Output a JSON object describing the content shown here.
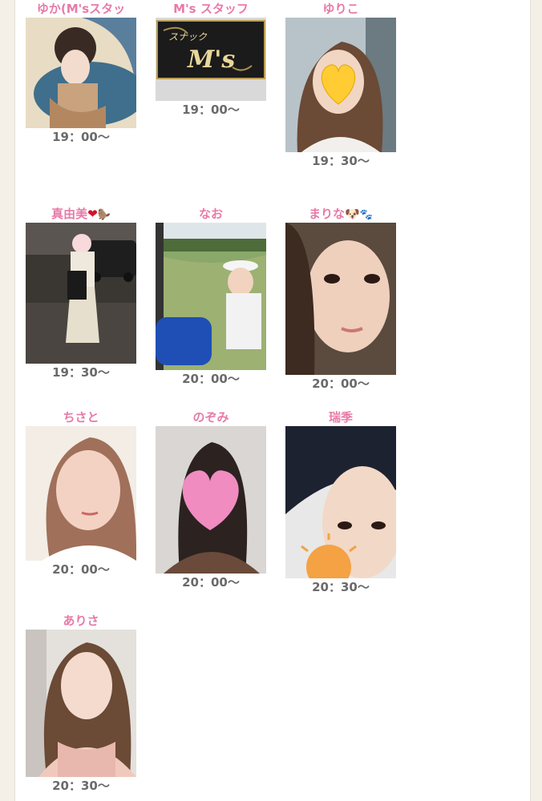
{
  "cast": [
    {
      "name": "ゆか(M'sスタッ",
      "time": "19：00〜",
      "photo_icon": "illustrated-woman-portrait"
    },
    {
      "name": "M's スタッフ",
      "time": "19：00〜",
      "photo_icon": "snack-ms-sign"
    },
    {
      "name": "ゆりこ",
      "time": "19：30〜",
      "photo_icon": "yellow-heart-face-cover"
    },
    {
      "name": "真由美",
      "name_suffix": "❤",
      "name_suffix2": "🦫",
      "time": "19：30〜",
      "photo_icon": "street-night-photo"
    },
    {
      "name": "なお",
      "time": "20：00〜",
      "photo_icon": "golf-cart-photo"
    },
    {
      "name": "まりな",
      "name_suffix": "🐶",
      "name_suffix2": "🐾",
      "time": "20：00〜",
      "photo_icon": "selfie-portrait"
    },
    {
      "name": "ちさと",
      "time": "20：00〜",
      "photo_icon": "selfie-portrait"
    },
    {
      "name": "のぞみ",
      "time": "20：00〜",
      "photo_icon": "pink-heart-face-cover"
    },
    {
      "name": "瑞季",
      "time": "20：30〜",
      "photo_icon": "orange-sun-cover"
    },
    {
      "name": "ありさ",
      "time": "20：30〜",
      "photo_icon": "selfie-portrait"
    }
  ]
}
